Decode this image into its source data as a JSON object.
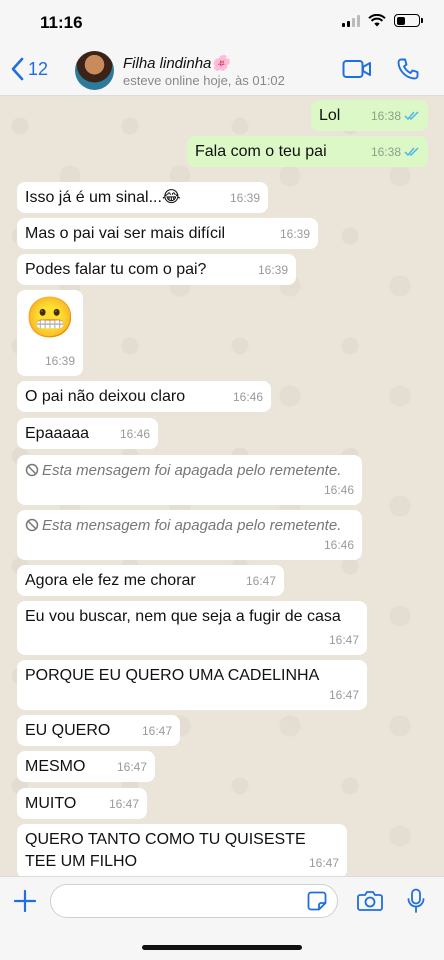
{
  "status_bar": {
    "time": "11:16"
  },
  "header": {
    "back_count": "12",
    "contact_name": "Filha lindinha🌸",
    "contact_status": "esteve online hoje, às 01:02"
  },
  "messages": [
    {
      "dir": "out",
      "text": "Lol",
      "time": "16:38",
      "read": true
    },
    {
      "dir": "out",
      "text": "Fala com o teu pai",
      "time": "16:38",
      "read": true
    },
    {
      "dir": "in",
      "text": "Isso já é um sinal...😂",
      "time": "16:39"
    },
    {
      "dir": "in",
      "text": "Mas o pai vai ser mais difícil",
      "time": "16:39"
    },
    {
      "dir": "in",
      "text": "Podes falar tu com o pai?",
      "time": "16:39"
    },
    {
      "dir": "in",
      "text": "😬",
      "time": "16:39"
    },
    {
      "dir": "in",
      "text": "O pai não deixou claro",
      "time": "16:46"
    },
    {
      "dir": "in",
      "text": "Epaaaaa",
      "time": "16:46"
    },
    {
      "dir": "in",
      "text": "Esta mensagem foi apagada pelo remetente.",
      "time": "16:46",
      "deleted": true
    },
    {
      "dir": "in",
      "text": "Esta mensagem foi apagada pelo remetente.",
      "time": "16:46",
      "deleted": true
    },
    {
      "dir": "in",
      "text": "Agora ele fez me chorar",
      "time": "16:47"
    },
    {
      "dir": "in",
      "text": "Eu vou buscar, nem que seja a fugir de casa",
      "time": "16:47"
    },
    {
      "dir": "in",
      "text": "PORQUE EU QUERO UMA CADELINHA",
      "time": "16:47"
    },
    {
      "dir": "in",
      "text": "EU QUERO",
      "time": "16:47"
    },
    {
      "dir": "in",
      "text": "MESMO",
      "time": "16:47"
    },
    {
      "dir": "in",
      "text": "MUITO",
      "time": "16:47"
    },
    {
      "dir": "in",
      "text": "QUERO TANTO COMO TU QUISESTE TEE UM FILHO",
      "time": "16:47"
    }
  ],
  "input": {
    "placeholder": ""
  },
  "colors": {
    "accent": "#1f6fe0",
    "outgoing_bubble": "#dcf8c6",
    "incoming_bubble": "#ffffff",
    "read_ticks": "#4fb6ec"
  },
  "icons": [
    "back-chevron-icon",
    "video-call-icon",
    "phone-icon",
    "plus-icon",
    "sticker-icon",
    "camera-icon",
    "microphone-icon",
    "chevron-down-icon",
    "ban-icon",
    "double-check-icon"
  ]
}
